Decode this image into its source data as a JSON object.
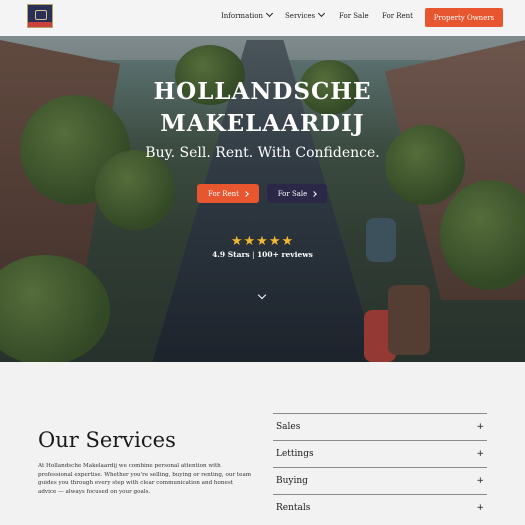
{
  "nav": {
    "items": [
      {
        "label": "Information",
        "has_dropdown": true
      },
      {
        "label": "Services",
        "has_dropdown": true
      },
      {
        "label": "For Sale",
        "has_dropdown": false
      },
      {
        "label": "For Rent",
        "has_dropdown": false
      }
    ],
    "cta_label": "Property Owners",
    "logo_icon": "crest-logo-icon"
  },
  "hero": {
    "title_line1": "HOLLANDSCHE",
    "title_line2": "MAKELAARDIJ",
    "subtitle": "Buy. Sell. Rent. With Confidence.",
    "buttons": [
      {
        "label": "For Rent",
        "color": "#e8562f"
      },
      {
        "label": "For Sale",
        "color": "#2a2846"
      }
    ],
    "stars": "★★★★★",
    "star_count": 5,
    "rating_value": "4.9 Stars",
    "separator": "|",
    "reviews": "100+ reviews",
    "scroll_icon": "chevron-down-icon"
  },
  "services": {
    "title": "Our Services",
    "description": "At Hollandsche Makelaardij we combine personal attention with professional expertise. Whether you're selling, buying or renting, our team guides you through every step with clear communication and honest advice — always focused on your goals.",
    "accordion": [
      {
        "label": "Sales",
        "icon": "+"
      },
      {
        "label": "Lettings",
        "icon": "+"
      },
      {
        "label": "Buying",
        "icon": "+"
      },
      {
        "label": "Rentals",
        "icon": "+"
      }
    ]
  },
  "colors": {
    "accent": "#e8562f",
    "dark_button": "#2a2846",
    "star": "#f1b830",
    "page_bg": "#f2f2f2"
  }
}
